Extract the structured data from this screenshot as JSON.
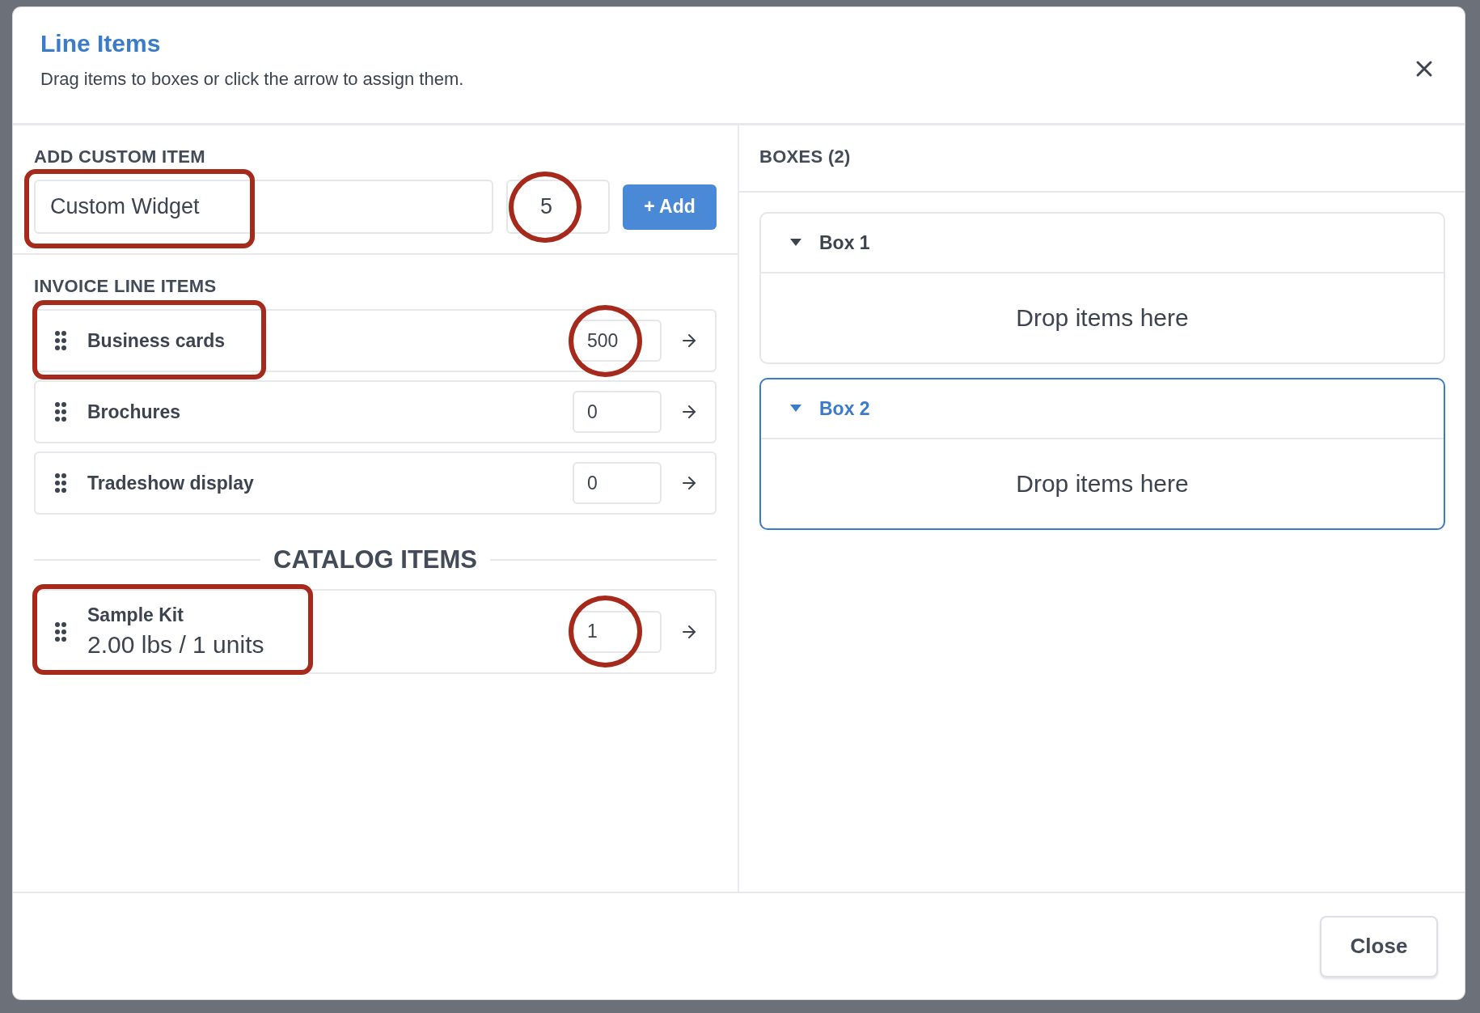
{
  "dialog": {
    "title": "Line Items",
    "subtitle": "Drag items to boxes or click the arrow to assign them."
  },
  "custom_item": {
    "heading": "ADD CUSTOM ITEM",
    "name": {
      "value": "Custom Widget",
      "highlighted": true
    },
    "quantity": {
      "value": "5",
      "highlighted": true
    },
    "add_button": "+ Add"
  },
  "invoice_items": {
    "heading": "INVOICE LINE ITEMS",
    "items": [
      {
        "name": "Business cards",
        "quantity": "500",
        "name_highlighted": true,
        "quantity_highlighted": true
      },
      {
        "name": "Brochures",
        "quantity": "0",
        "name_highlighted": false,
        "quantity_highlighted": false
      },
      {
        "name": "Tradeshow display",
        "quantity": "0",
        "name_highlighted": false,
        "quantity_highlighted": false
      }
    ]
  },
  "catalog": {
    "heading": "CATALOG ITEMS",
    "items": [
      {
        "name": "Sample Kit",
        "detail": "2.00 lbs / 1 units",
        "quantity": "1",
        "name_highlighted": true,
        "quantity_highlighted": true
      }
    ]
  },
  "boxes": {
    "heading": "BOXES (2)",
    "items": [
      {
        "name": "Box 1",
        "empty_text": "Drop items here",
        "selected": false,
        "expanded": true
      },
      {
        "name": "Box 2",
        "empty_text": "Drop items here",
        "selected": true,
        "expanded": true
      }
    ]
  },
  "footer": {
    "close_button": "Close"
  }
}
